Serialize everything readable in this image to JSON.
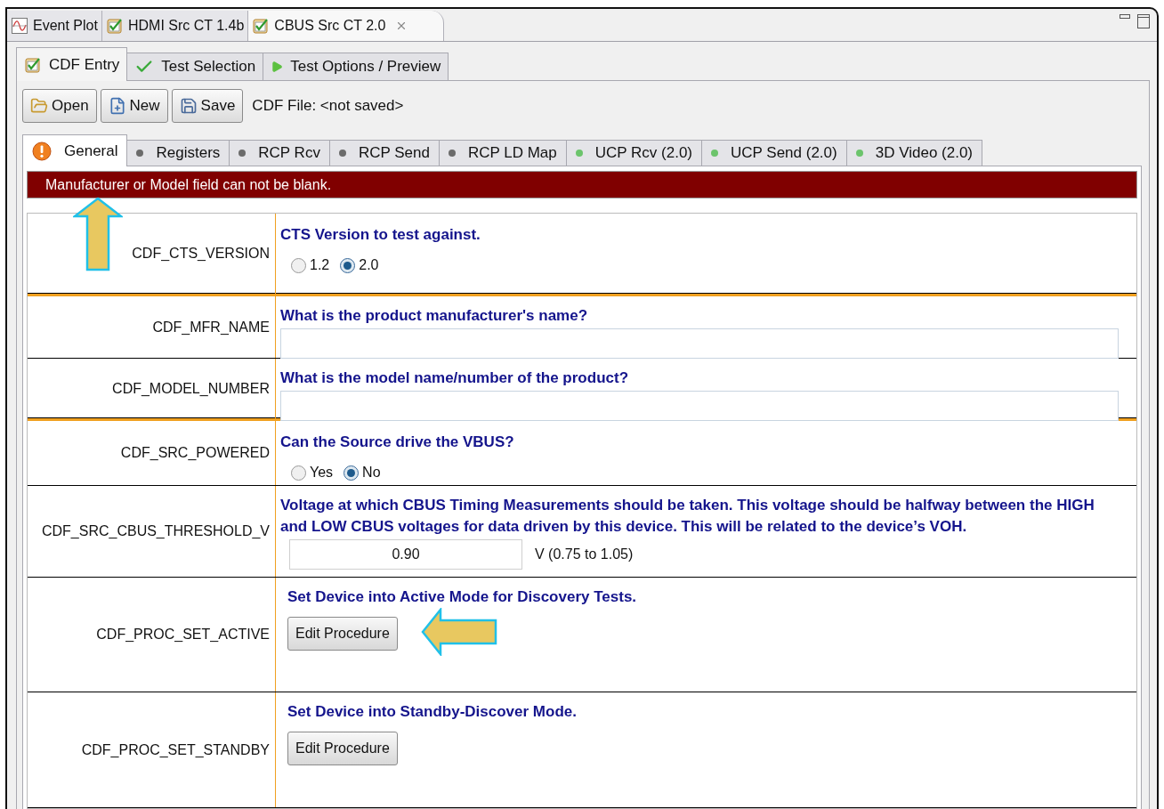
{
  "editor_tabs": [
    {
      "label": "Event Plot",
      "kind": "plot",
      "selected": false,
      "closable": false
    },
    {
      "label": "HDMI Src CT 1.4b",
      "kind": "test",
      "selected": false,
      "closable": false
    },
    {
      "label": "CBUS Src CT 2.0",
      "kind": "test",
      "selected": true,
      "closable": true
    }
  ],
  "sub_tabs": [
    {
      "label": "CDF Entry",
      "kind": "test",
      "selected": true
    },
    {
      "label": "Test Selection",
      "kind": "check",
      "selected": false
    },
    {
      "label": "Test Options / Preview",
      "kind": "play",
      "selected": false
    }
  ],
  "toolbar": {
    "buttons": [
      {
        "label": "Open",
        "kind": "open"
      },
      {
        "label": "New",
        "kind": "new"
      },
      {
        "label": "Save",
        "kind": "save"
      }
    ],
    "file_label": "CDF File: <not saved>"
  },
  "section_tabs": [
    {
      "label": "General",
      "kind": "warning",
      "selected": true
    },
    {
      "label": "Registers",
      "kind": "dot",
      "color": "#6b6b6b",
      "selected": false
    },
    {
      "label": "RCP Rcv",
      "kind": "dot",
      "color": "#6b6b6b",
      "selected": false
    },
    {
      "label": "RCP Send",
      "kind": "dot",
      "color": "#6b6b6b",
      "selected": false
    },
    {
      "label": "RCP LD Map",
      "kind": "dot",
      "color": "#6b6b6b",
      "selected": false
    },
    {
      "label": "UCP Rcv (2.0)",
      "kind": "dot",
      "color": "#6cc46c",
      "selected": false
    },
    {
      "label": "UCP Send (2.0)",
      "kind": "dot",
      "color": "#6cc46c",
      "selected": false
    },
    {
      "label": "3D Video (2.0)",
      "kind": "dot",
      "color": "#6cc46c",
      "selected": false
    }
  ],
  "error_banner": "Manufacturer or Model field can not be blank.",
  "rows": [
    {
      "name": "CDF_CTS_VERSION",
      "kind": "radio",
      "question": "CTS Version to test against.",
      "options": [
        {
          "label": "1.2",
          "selected": false
        },
        {
          "label": "2.0",
          "selected": true
        }
      ],
      "group_end": true
    },
    {
      "name": "CDF_MFR_NAME",
      "kind": "text",
      "question": "What is the product manufacturer's name?",
      "group_end": false
    },
    {
      "name": "CDF_MODEL_NUMBER",
      "kind": "text",
      "question": "What is the model name/number of the product?",
      "group_end": true
    },
    {
      "name": "CDF_SRC_POWERED",
      "kind": "radio",
      "question": "Can the Source drive the VBUS?",
      "options": [
        {
          "label": "Yes",
          "selected": false
        },
        {
          "label": "No",
          "selected": true
        }
      ],
      "group_end": false
    },
    {
      "name": "CDF_SRC_CBUS_THRESHOLD_V",
      "kind": "number",
      "question": "Voltage at which CBUS Timing Measurements should be taken. This voltage should be halfway between the HIGH and LOW CBUS voltages for data driven by this device. This will be related to the device’s VOH.",
      "value": "0.90",
      "unit": "V (0.75 to 1.05)",
      "group_end": false
    },
    {
      "name": "CDF_PROC_SET_ACTIVE",
      "kind": "procedure",
      "question": "Set Device into Active Mode for Discovery Tests.",
      "button": "Edit Procedure",
      "group_end": false
    },
    {
      "name": "CDF_PROC_SET_STANDBY",
      "kind": "procedure",
      "question": "Set Device into Standby-Discover Mode.",
      "button": "Edit Procedure",
      "group_end": false
    }
  ]
}
